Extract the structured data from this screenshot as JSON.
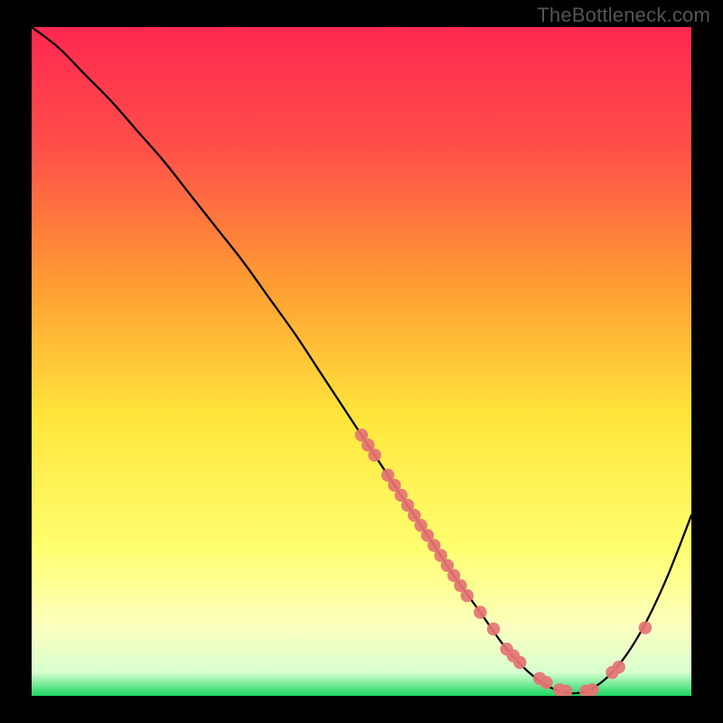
{
  "watermark": "TheBottleneck.com",
  "chart_data": {
    "type": "line",
    "title": "",
    "xlabel": "",
    "ylabel": "",
    "xlim": [
      0,
      100
    ],
    "ylim": [
      0,
      100
    ],
    "grid": false,
    "legend": false,
    "background_gradient": {
      "top": "#ff2851",
      "upper_mid": "#ff7a33",
      "mid": "#ffe53b",
      "lower_mid": "#ffff8f",
      "lower": "#f5ffd0",
      "bottom": "#1bd660"
    },
    "series": [
      {
        "name": "bottleneck-curve",
        "type": "line",
        "color": "#000000",
        "x": [
          0,
          4,
          8,
          12,
          16,
          20,
          24,
          28,
          32,
          36,
          40,
          44,
          48,
          52,
          56,
          60,
          64,
          68,
          72,
          76,
          80,
          84,
          88,
          92,
          96,
          100
        ],
        "y": [
          100,
          97,
          93,
          89,
          84.5,
          80,
          75,
          70,
          65,
          59.5,
          54,
          48,
          42,
          36,
          30,
          24,
          18,
          12.5,
          7,
          3,
          0.7,
          0.7,
          3.5,
          9,
          17,
          27
        ]
      },
      {
        "name": "data-points",
        "type": "scatter",
        "color": "#e57373",
        "x": [
          50,
          51,
          52,
          54,
          55,
          56,
          57,
          58,
          59,
          60,
          61,
          62,
          63,
          64,
          65,
          66,
          68,
          70,
          72,
          73,
          74,
          77,
          78,
          80,
          81,
          84,
          85,
          88,
          89,
          93
        ],
        "y": [
          39,
          37.5,
          36,
          33,
          31.5,
          30,
          28.5,
          27,
          25.5,
          24,
          22.5,
          21,
          19.5,
          18,
          16.5,
          15,
          12.5,
          10,
          7,
          6,
          5,
          2.6,
          2,
          0.9,
          0.7,
          0.7,
          0.9,
          3.5,
          4.3,
          10.2
        ]
      }
    ]
  }
}
